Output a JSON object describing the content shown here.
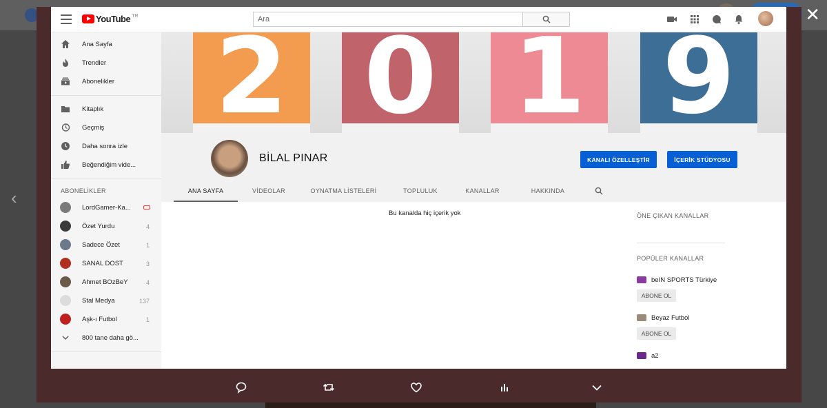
{
  "browser": {
    "close_label": "✕",
    "prev_label": "‹"
  },
  "youtube": {
    "logo_text": "YouTube",
    "logo_country": "TR",
    "search_placeholder": "Ara"
  },
  "sidebar": {
    "main_items": [
      {
        "label": "Ana Sayfa",
        "icon": "home-icon"
      },
      {
        "label": "Trendler",
        "icon": "flame-icon"
      },
      {
        "label": "Abonelikler",
        "icon": "subscriptions-icon"
      }
    ],
    "library_items": [
      {
        "label": "Kitaplık",
        "icon": "folder-icon"
      },
      {
        "label": "Geçmiş",
        "icon": "history-icon"
      },
      {
        "label": "Daha sonra izle",
        "icon": "clock-icon"
      },
      {
        "label": "Beğendiğim vide...",
        "icon": "thumbs-up-icon"
      }
    ],
    "subscriptions_header": "ABONELİKLER",
    "subscriptions": [
      {
        "label": "LordGamer-Ka...",
        "count": "",
        "live": true,
        "color": "#7a7a7a"
      },
      {
        "label": "Özet Yurdu",
        "count": "4",
        "live": false,
        "color": "#3a3a3a"
      },
      {
        "label": "Sadece Özet",
        "count": "1",
        "live": false,
        "color": "#6a7a8a"
      },
      {
        "label": "SANAL DOST",
        "count": "3",
        "live": false,
        "color": "#b03020"
      },
      {
        "label": "Ahmet BOzBeY",
        "count": "4",
        "live": false,
        "color": "#6a5a4a"
      },
      {
        "label": "Stal Medya",
        "count": "137",
        "live": false,
        "color": "#dcdcdc"
      },
      {
        "label": "Aşk-ı Futbol",
        "count": "1",
        "live": false,
        "color": "#c02020"
      }
    ],
    "more_label": "800 tane daha gö..."
  },
  "banner": {
    "digits": [
      {
        "value": "2",
        "color": "#f39b4e"
      },
      {
        "value": "0",
        "color": "#c0636b"
      },
      {
        "value": "1",
        "color": "#ee8a93"
      },
      {
        "value": "9",
        "color": "#3d6e95"
      }
    ]
  },
  "channel": {
    "name": "BİLAL PINAR",
    "customize_label": "KANALI ÖZELLEŞTİR",
    "studio_label": "İÇERİK STÜDYOSU",
    "tabs": [
      "ANA SAYFA",
      "VİDEOLAR",
      "OYNATMA LİSTELERİ",
      "TOPLULUK",
      "KANALLAR",
      "HAKKINDA"
    ],
    "active_tab": "ANA SAYFA",
    "empty_message": "Bu kanalda hiç içerik yok"
  },
  "side_panel": {
    "featured_header": "ÖNE ÇIKAN KANALLAR",
    "popular_header": "POPÜLER KANALLAR",
    "channels": [
      {
        "name": "beIN SPORTS Türkiye",
        "subscribe": "ABONE OL",
        "color": "#8a3aa0"
      },
      {
        "name": "Beyaz Futbol",
        "subscribe": "ABONE OL",
        "color": "#9a8a7a"
      },
      {
        "name": "a2",
        "subscribe": "",
        "color": "#6a2a8a"
      }
    ]
  },
  "bottom_actions": [
    "reply-icon",
    "retweet-icon",
    "like-icon",
    "analytics-icon",
    "more-icon"
  ]
}
